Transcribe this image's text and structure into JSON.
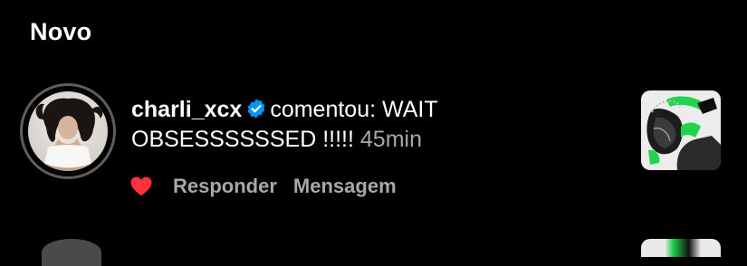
{
  "section": {
    "title": "Novo"
  },
  "notification": {
    "username": "charli_xcx",
    "verified": true,
    "verb": "comentou:",
    "comment": "WAIT OBSESSSSSSED !!!!!",
    "time": "45min",
    "actions": {
      "reply_label": "Responder",
      "message_label": "Mensagem"
    },
    "liked": true
  },
  "colors": {
    "background": "#000000",
    "text_primary": "#ffffff",
    "text_secondary": "#a8a8a8",
    "verified_blue": "#0095f6",
    "like_red": "#ff3040",
    "avatar_ring": "#5e5e5e"
  },
  "icons": {
    "verified": "verified-badge-icon",
    "like": "heart-filled-icon"
  }
}
